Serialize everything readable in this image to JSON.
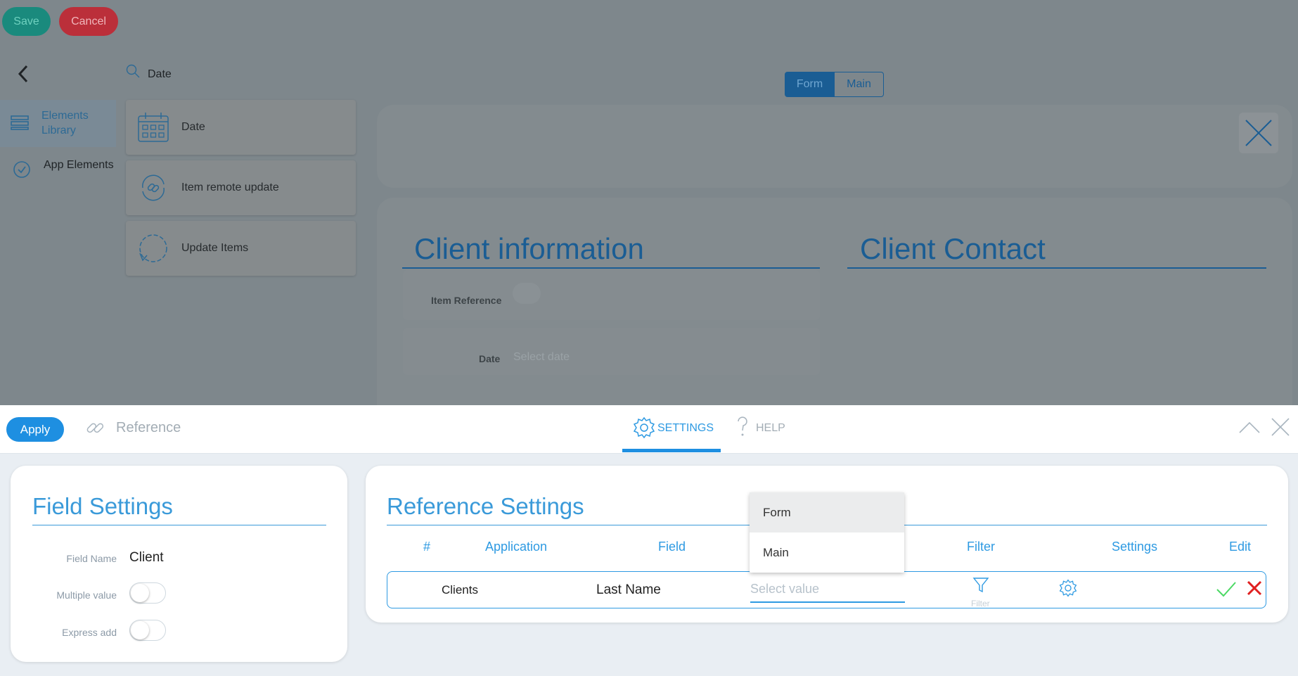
{
  "toolbar": {
    "save_label": "Save",
    "cancel_label": "Cancel"
  },
  "sidebar": {
    "items": [
      {
        "label": "Elements Library",
        "icon": "layers-icon",
        "active": true
      },
      {
        "label": "App Elements",
        "icon": "check-circle-icon",
        "active": false
      }
    ]
  },
  "library": {
    "search_value": "Date",
    "cards": [
      {
        "label": "Date",
        "icon": "calendar-icon"
      },
      {
        "label": "Item remote update",
        "icon": "link-refresh-icon"
      },
      {
        "label": "Update Items",
        "icon": "refresh-circle-icon"
      }
    ]
  },
  "view_switch": {
    "options": [
      "Form",
      "Main"
    ],
    "selected": "Form"
  },
  "form_preview": {
    "sections": [
      {
        "title": "Client information"
      },
      {
        "title": "Client Contact"
      }
    ],
    "fields": [
      {
        "label": "Item Reference",
        "type": "toggle"
      },
      {
        "label": "Date",
        "placeholder": "Select date"
      }
    ]
  },
  "settings_bar": {
    "apply_label": "Apply",
    "element_name": "Reference",
    "tabs": [
      {
        "label": "SETTINGS",
        "active": true
      },
      {
        "label": "HELP",
        "active": false
      }
    ]
  },
  "field_settings": {
    "title": "Field Settings",
    "rows": [
      {
        "label": "Field Name",
        "value": "Client"
      },
      {
        "label": "Multiple value",
        "type": "toggle",
        "on": false
      },
      {
        "label": "Express add",
        "type": "toggle",
        "on": false
      }
    ]
  },
  "reference_settings": {
    "title": "Reference Settings",
    "columns": [
      "#",
      "Application",
      "Field",
      "Filter",
      "Settings",
      "Edit"
    ],
    "row": {
      "application": "Clients",
      "field": "Last Name",
      "select_placeholder": "Select value",
      "filter_label": "Filter"
    },
    "dropdown_options": [
      "Form",
      "Main"
    ],
    "dropdown_highlighted": "Form"
  },
  "colors": {
    "accent": "#2e9ae2",
    "save": "#1a8a7d",
    "cancel": "#bb2f3a",
    "confirm": "#4cd964",
    "reject": "#e02020"
  }
}
